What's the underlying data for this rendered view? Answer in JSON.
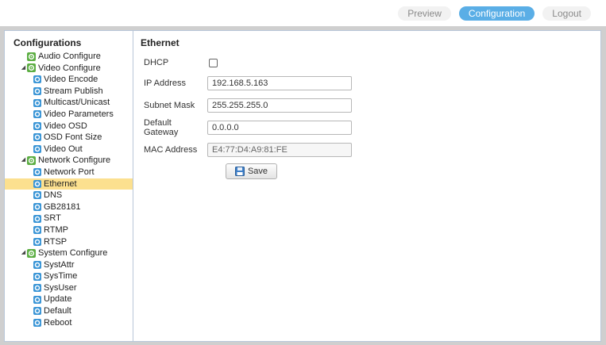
{
  "topnav": {
    "items": [
      {
        "label": "Preview",
        "active": false
      },
      {
        "label": "Configuration",
        "active": true
      },
      {
        "label": "Logout",
        "active": false
      }
    ]
  },
  "sidebar": {
    "title": "Configurations",
    "selected": "Ethernet",
    "groups": [
      {
        "label": "Audio Configure",
        "icon": "gear-icon",
        "expanded": null,
        "children": []
      },
      {
        "label": "Video Configure",
        "icon": "gear-icon",
        "expanded": true,
        "children": [
          "Video Encode",
          "Stream Publish",
          "Multicast/Unicast",
          "Video Parameters",
          "Video OSD",
          "OSD Font Size",
          "Video Out"
        ]
      },
      {
        "label": "Network Configure",
        "icon": "gear-icon",
        "expanded": true,
        "children": [
          "Network Port",
          "Ethernet",
          "DNS",
          "GB28181",
          "SRT",
          "RTMP",
          "RTSP"
        ]
      },
      {
        "label": "System Configure",
        "icon": "gear-icon",
        "expanded": true,
        "children": [
          "SystAttr",
          "SysTime",
          "SysUser",
          "Update",
          "Default",
          "Reboot"
        ]
      }
    ]
  },
  "ethernet": {
    "title": "Ethernet",
    "dhcp_label": "DHCP",
    "dhcp_checked": false,
    "ip_label": "IP Address",
    "ip_value": "192.168.5.163",
    "mask_label": "Subnet Mask",
    "mask_value": "255.255.255.0",
    "gateway_label": "Default Gateway",
    "gateway_value": "0.0.0.0",
    "mac_label": "MAC Address",
    "mac_value": "E4:77:D4:A9:81:FE",
    "save_label": "Save"
  },
  "colors": {
    "accent": "#5aaee6",
    "selected_row": "#fce08f",
    "group_icon": "#5cae43",
    "leaf_icon": "#3a95d6"
  }
}
